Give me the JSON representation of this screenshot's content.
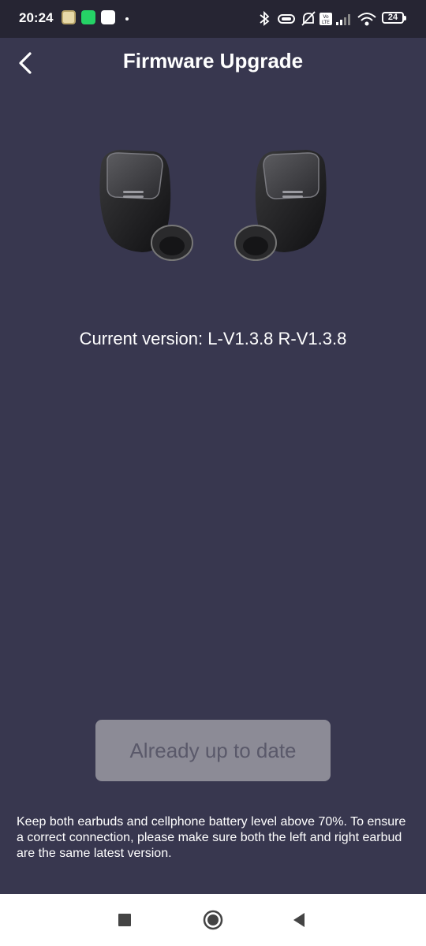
{
  "status_bar": {
    "time": "20:24",
    "battery": "24",
    "icons": [
      "bluetooth-icon",
      "vibrate-icon",
      "mute-icon",
      "volte-icon",
      "signal-icon",
      "wifi-icon",
      "battery-icon"
    ],
    "app_icons": [
      "app-notification-icon",
      "whatsapp-icon",
      "app-notification-icon"
    ]
  },
  "header": {
    "title": "Firmware Upgrade",
    "back_icon": "chevron-left-icon"
  },
  "device": {
    "image": "earbuds-image",
    "current_version": "Current version: L-V1.3.8 R-V1.3.8"
  },
  "update_button": {
    "label": "Already up to date",
    "enabled": false
  },
  "note": "Keep both earbuds and cellphone battery level above 70%. To ensure a correct connection, please make sure both the left and right earbud are the same latest version.",
  "nav_bar": {
    "buttons": [
      "recents-square-icon",
      "home-circle-icon",
      "back-triangle-icon"
    ]
  },
  "colors": {
    "background": "#38374f",
    "status_bar": "#262533",
    "button_disabled": "#8c8b96",
    "button_text": "#5a596a"
  }
}
